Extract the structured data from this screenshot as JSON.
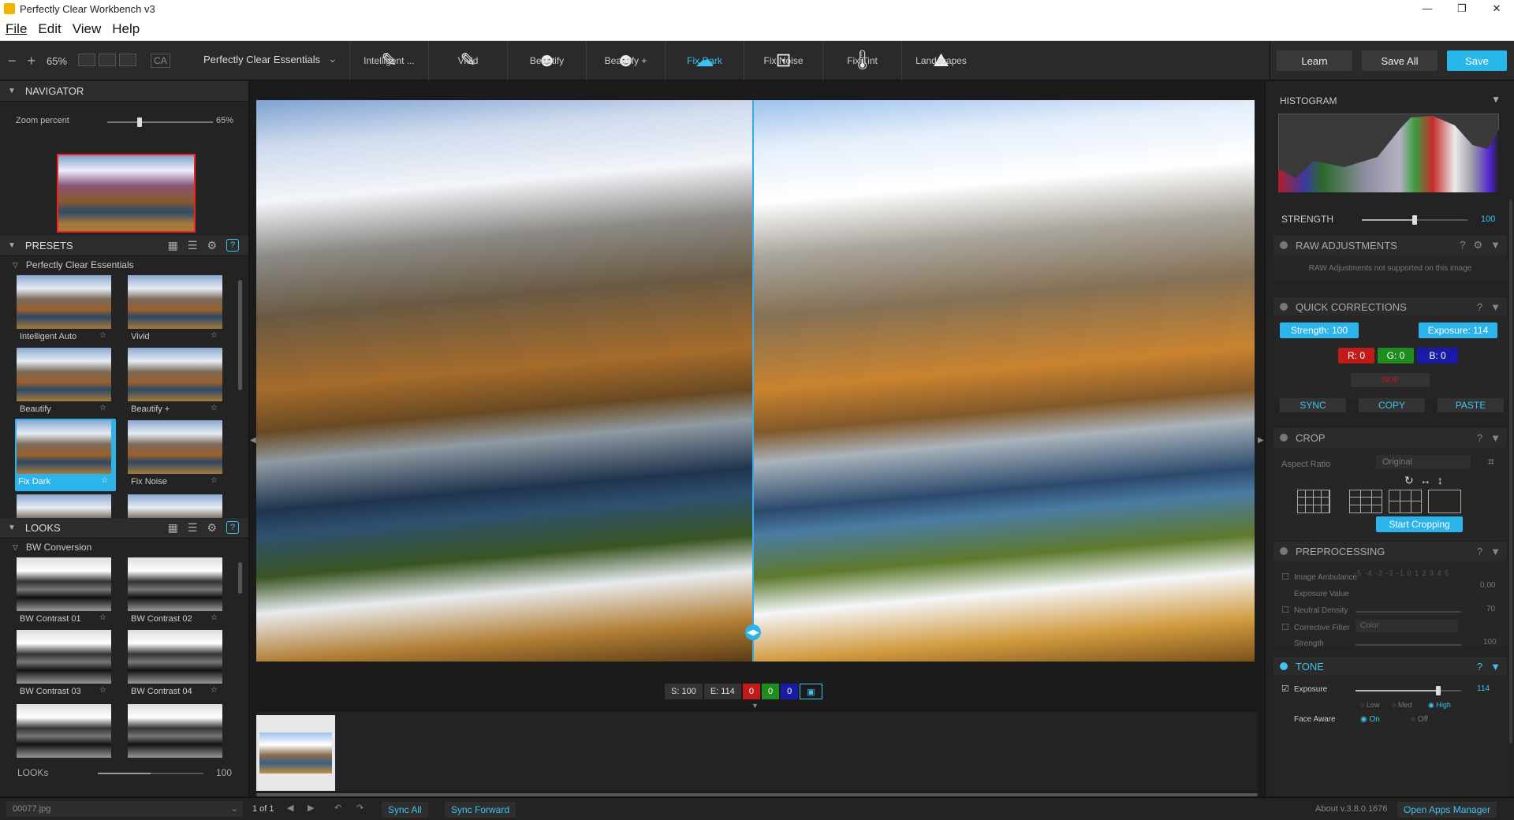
{
  "window": {
    "title": "Perfectly Clear Workbench v3",
    "controls": [
      "—",
      "❐",
      "✕"
    ]
  },
  "menu": [
    "File",
    "Edit",
    "View",
    "Help"
  ],
  "toolbar": {
    "zoom": "65%",
    "ca_label": "CA",
    "preset_group": "Perfectly Clear Essentials",
    "tools": [
      {
        "label": "Intelligent ...",
        "icon": "hd-brush-icon",
        "glyph": "✎",
        "active": false
      },
      {
        "label": "Vivid",
        "icon": "brush-icon",
        "glyph": "✎",
        "active": false
      },
      {
        "label": "Beautify",
        "icon": "face-icon",
        "glyph": "☻",
        "active": false
      },
      {
        "label": "Beautify +",
        "icon": "face-plus-icon",
        "glyph": "☻",
        "active": false
      },
      {
        "label": "Fix Dark",
        "icon": "clouds-icon",
        "glyph": "☁",
        "active": true
      },
      {
        "label": "Fix Noise",
        "icon": "noise-icon",
        "glyph": "⊡",
        "active": false
      },
      {
        "label": "Fix Tint",
        "icon": "thermometer-icon",
        "glyph": "🌡",
        "active": false
      },
      {
        "label": "Landscapes",
        "icon": "landscape-icon",
        "glyph": "⛰",
        "active": false
      }
    ],
    "learn": "Learn",
    "save_all": "Save All",
    "save": "Save"
  },
  "navigator": {
    "title": "NAVIGATOR",
    "zoom_label": "Zoom percent",
    "zoom_value": "65%",
    "zoom_fraction": 0.28
  },
  "presets": {
    "title": "PRESETS",
    "group": "Perfectly Clear Essentials",
    "items": [
      "Intelligent Auto",
      "Vivid",
      "Beautify",
      "Beautify +",
      "Fix Dark",
      "Fix Noise"
    ],
    "selected": "Fix Dark"
  },
  "looks": {
    "title": "LOOKS",
    "group": "BW Conversion",
    "items": [
      "BW Contrast 01",
      "BW Contrast 02",
      "BW Contrast 03",
      "BW Contrast 04"
    ],
    "footer_label": "LOOKs",
    "footer_value": "100",
    "footer_fraction": 0.5
  },
  "canvas": {
    "status": {
      "s": "S: 100",
      "e": "E: 114",
      "r": "0",
      "g": "0",
      "b": "0"
    }
  },
  "histogram": {
    "title": "HISTOGRAM",
    "strength_label": "STRENGTH",
    "strength_value": "100",
    "strength_fraction": 0.5
  },
  "raw": {
    "title": "RAW ADJUSTMENTS",
    "note": "RAW Adjustments not supported on this image"
  },
  "quick": {
    "title": "QUICK CORRECTIONS",
    "strength": "Strength: 100",
    "exposure": "Exposure: 114",
    "r": "R: 0",
    "g": "G: 0",
    "b": "B: 0",
    "skip": "SKIP",
    "sync": "SYNC",
    "copy": "COPY",
    "paste": "PASTE"
  },
  "crop": {
    "title": "CROP",
    "aspect_label": "Aspect Ratio",
    "aspect_value": "Original",
    "start": "Start Cropping"
  },
  "preprocessing": {
    "title": "PREPROCESSING",
    "ambulance_label": "Image Ambulance",
    "ambulance_scale": "-5 -4 -3 -2 -1 0 1 2 3 4 5",
    "exposure_label": "Exposure Value",
    "exposure_value": "0,00",
    "nd_label": "Neutral Density",
    "nd_value": "70",
    "cf_label": "Corrective Filter",
    "cf_value": "Color",
    "strength_label": "Strength",
    "strength_value": "100"
  },
  "tone": {
    "title": "TONE",
    "exposure_label": "Exposure",
    "exposure_value": "114",
    "exposure_fraction": 0.78,
    "levels": [
      "Low",
      "Med",
      "High"
    ],
    "face_label": "Face Aware",
    "face_on": "On",
    "face_off": "Off"
  },
  "statusbar": {
    "file": "00077.jpg",
    "page": "1 of 1",
    "sync_all": "Sync All",
    "sync_forward": "Sync Forward",
    "version": "About v.3.8.0.1676",
    "apps": "Open Apps Manager"
  }
}
